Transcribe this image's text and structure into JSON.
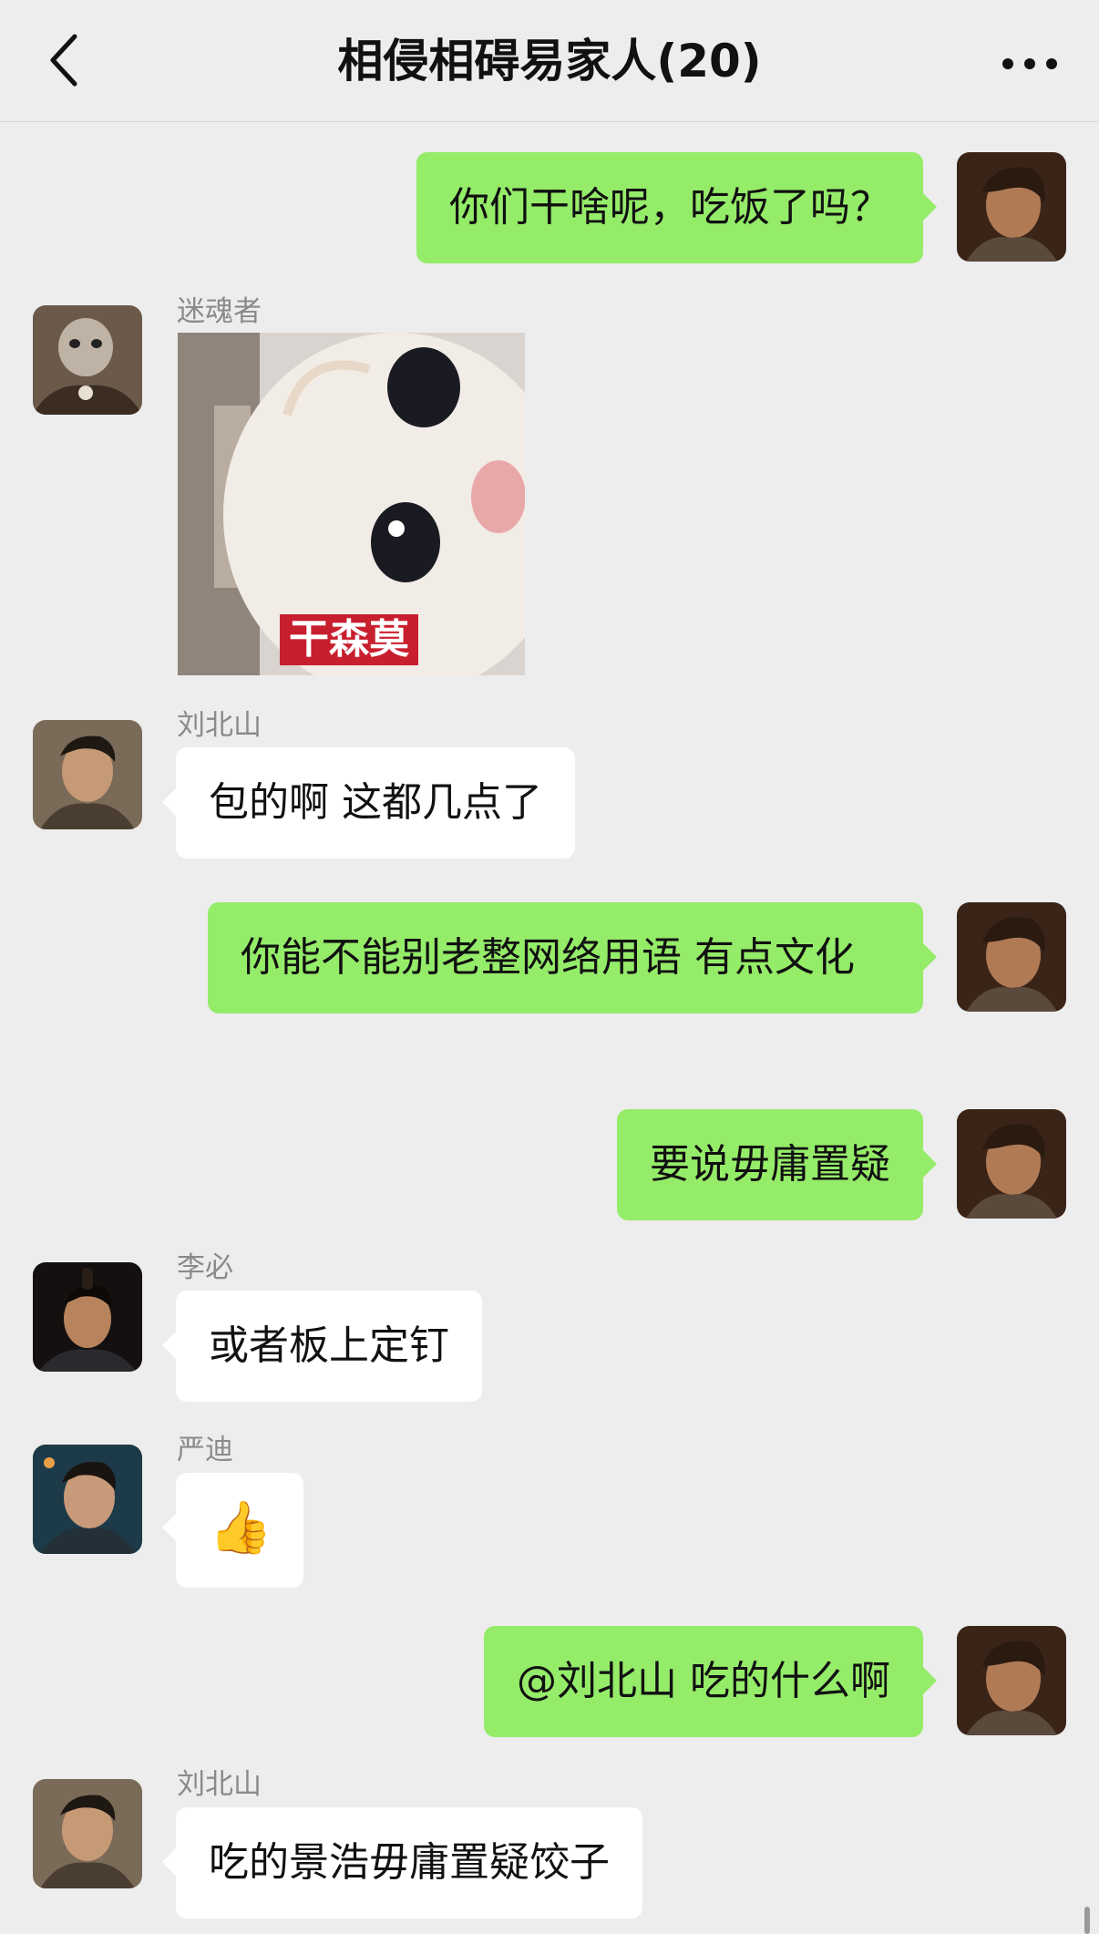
{
  "header": {
    "title": "相侵相碍易家人(20)",
    "back_icon": "chevron-left-icon",
    "more_icon": "more-dots-icon"
  },
  "messages": [
    {
      "sender": "",
      "direction": "out",
      "text": "你们干啥呢，吃饭了吗？"
    },
    {
      "sender": "迷魂者",
      "direction": "in",
      "type": "sticker",
      "sticker_caption": "干森莫"
    },
    {
      "sender": "刘北山",
      "direction": "in",
      "text": "包的啊 这都几点了"
    },
    {
      "sender": "",
      "direction": "out",
      "text": "你能不能别老整网络用语 有点文化"
    },
    {
      "sender": "",
      "direction": "out",
      "text": "要说毋庸置疑"
    },
    {
      "sender": "李必",
      "direction": "in",
      "text": "或者板上定钉"
    },
    {
      "sender": "严迪",
      "direction": "in",
      "text": "👍"
    },
    {
      "sender": "",
      "direction": "out",
      "text": "@刘北山 吃的什么啊"
    },
    {
      "sender": "刘北山",
      "direction": "in",
      "text": "吃的景浩毋庸置疑饺子"
    }
  ],
  "colors": {
    "background": "#ededed",
    "outgoing_bubble": "#95ec69",
    "incoming_bubble": "#ffffff",
    "sender_name": "#8a8a8a"
  }
}
